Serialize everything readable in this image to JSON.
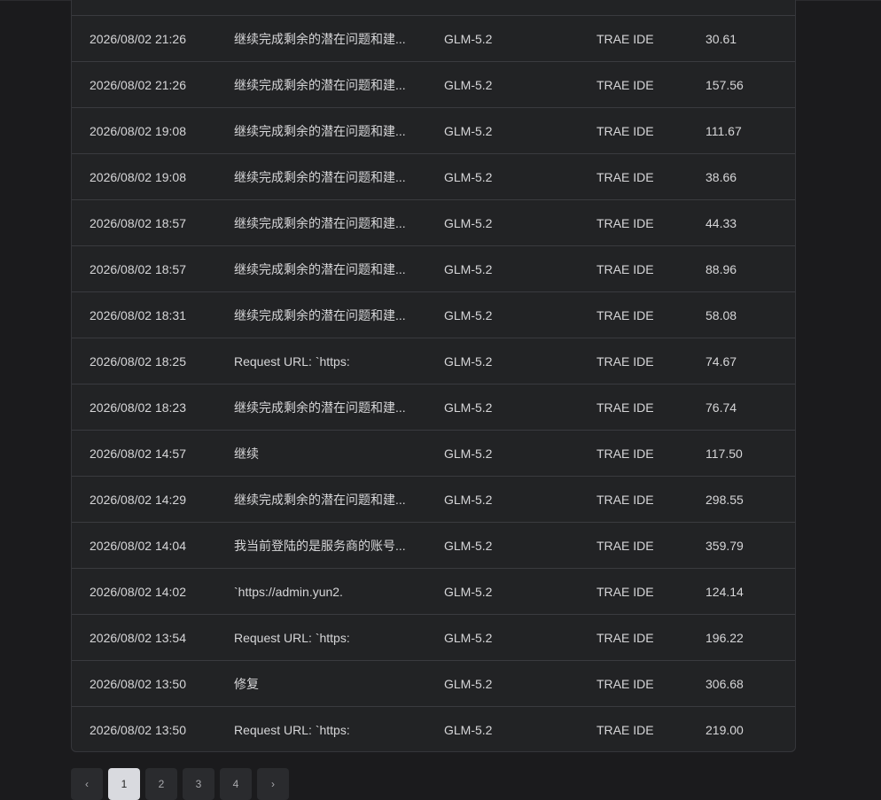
{
  "rows": [
    {
      "time": "2026/08/02 21:26",
      "message": "继续完成剩余的潜在问题和建...",
      "model": "GLM-5.2",
      "source": "TRAE IDE",
      "cost": "30.61"
    },
    {
      "time": "2026/08/02 21:26",
      "message": "继续完成剩余的潜在问题和建...",
      "model": "GLM-5.2",
      "source": "TRAE IDE",
      "cost": "157.56"
    },
    {
      "time": "2026/08/02 19:08",
      "message": "继续完成剩余的潜在问题和建...",
      "model": "GLM-5.2",
      "source": "TRAE IDE",
      "cost": "111.67"
    },
    {
      "time": "2026/08/02 19:08",
      "message": "继续完成剩余的潜在问题和建...",
      "model": "GLM-5.2",
      "source": "TRAE IDE",
      "cost": "38.66"
    },
    {
      "time": "2026/08/02 18:57",
      "message": "继续完成剩余的潜在问题和建...",
      "model": "GLM-5.2",
      "source": "TRAE IDE",
      "cost": "44.33"
    },
    {
      "time": "2026/08/02 18:57",
      "message": "继续完成剩余的潜在问题和建...",
      "model": "GLM-5.2",
      "source": "TRAE IDE",
      "cost": "88.96"
    },
    {
      "time": "2026/08/02 18:31",
      "message": "继续完成剩余的潜在问题和建...",
      "model": "GLM-5.2",
      "source": "TRAE IDE",
      "cost": "58.08"
    },
    {
      "time": "2026/08/02 18:25",
      "message": "Request URL: `https:",
      "model": "GLM-5.2",
      "source": "TRAE IDE",
      "cost": "74.67"
    },
    {
      "time": "2026/08/02 18:23",
      "message": "继续完成剩余的潜在问题和建...",
      "model": "GLM-5.2",
      "source": "TRAE IDE",
      "cost": "76.74"
    },
    {
      "time": "2026/08/02 14:57",
      "message": "继续",
      "model": "GLM-5.2",
      "source": "TRAE IDE",
      "cost": "117.50"
    },
    {
      "time": "2026/08/02 14:29",
      "message": "继续完成剩余的潜在问题和建...",
      "model": "GLM-5.2",
      "source": "TRAE IDE",
      "cost": "298.55"
    },
    {
      "time": "2026/08/02 14:04",
      "message": "我当前登陆的是服务商的账号...",
      "model": "GLM-5.2",
      "source": "TRAE IDE",
      "cost": "359.79"
    },
    {
      "time": "2026/08/02 14:02",
      "message": "`https://admin.yun2.",
      "model": "GLM-5.2",
      "source": "TRAE IDE",
      "cost": "124.14"
    },
    {
      "time": "2026/08/02 13:54",
      "message": "Request URL: `https:",
      "model": "GLM-5.2",
      "source": "TRAE IDE",
      "cost": "196.22"
    },
    {
      "time": "2026/08/02 13:50",
      "message": "修复",
      "model": "GLM-5.2",
      "source": "TRAE IDE",
      "cost": "306.68"
    },
    {
      "time": "2026/08/02 13:50",
      "message": "Request URL: `https:",
      "model": "GLM-5.2",
      "source": "TRAE IDE",
      "cost": "219.00"
    }
  ],
  "pagination": {
    "prev": "‹",
    "pages": [
      "1",
      "2",
      "3",
      "4"
    ],
    "next": "›",
    "current": "1"
  }
}
